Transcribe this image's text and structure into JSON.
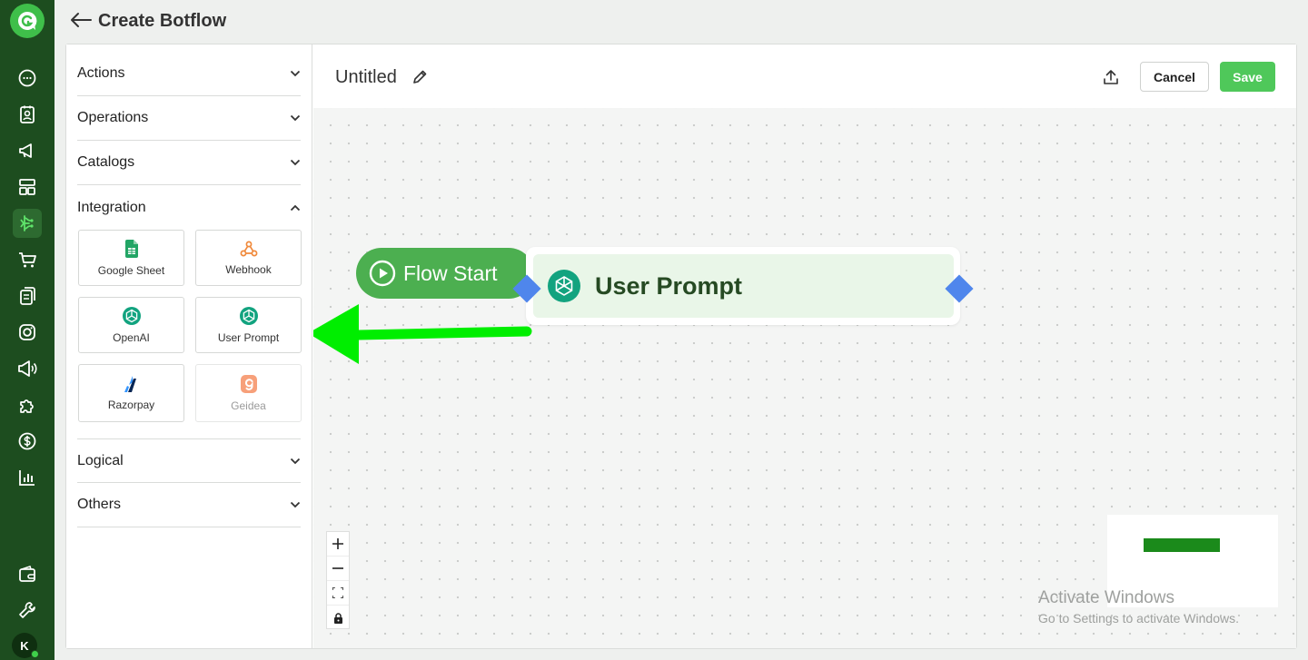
{
  "app": {
    "page_title": "Create Botflow",
    "avatar_initial": "K"
  },
  "sidebar_rail": {
    "icons": [
      "chat-icon",
      "contacts-icon",
      "megaphone-icon",
      "templates-icon",
      "botflow-icon",
      "cart-icon",
      "catalog-icon",
      "instagram-icon",
      "broadcast-icon",
      "integrations-icon",
      "payments-icon",
      "analytics-icon",
      "wallet-icon",
      "settings-wrench-icon"
    ],
    "active": "botflow-icon"
  },
  "palette": {
    "sections": {
      "actions": "Actions",
      "operations": "Operations",
      "catalogs": "Catalogs",
      "integration": "Integration",
      "logical": "Logical",
      "others": "Others"
    },
    "integration_cards": [
      {
        "label": "Google Sheet",
        "icon": "google-sheet-icon"
      },
      {
        "label": "Webhook",
        "icon": "webhook-icon"
      },
      {
        "label": "OpenAI",
        "icon": "openai-icon"
      },
      {
        "label": "User Prompt",
        "icon": "openai-icon"
      },
      {
        "label": "Razorpay",
        "icon": "razorpay-icon"
      },
      {
        "label": "Geidea",
        "icon": "geidea-icon"
      }
    ]
  },
  "toolbar": {
    "flow_name": "Untitled",
    "cancel_label": "Cancel",
    "save_label": "Save"
  },
  "canvas": {
    "flow_start_label": "Flow Start",
    "node_label": "User Prompt"
  },
  "watermark": {
    "title": "Activate Windows",
    "subtitle": "Go to Settings to activate Windows."
  },
  "colors": {
    "rail": "#1d4d1f",
    "accent": "#4fc85a",
    "flow_start": "#4caf50",
    "handle": "#4f86ec",
    "arrow": "#00ee00",
    "openai": "#12a37f"
  }
}
